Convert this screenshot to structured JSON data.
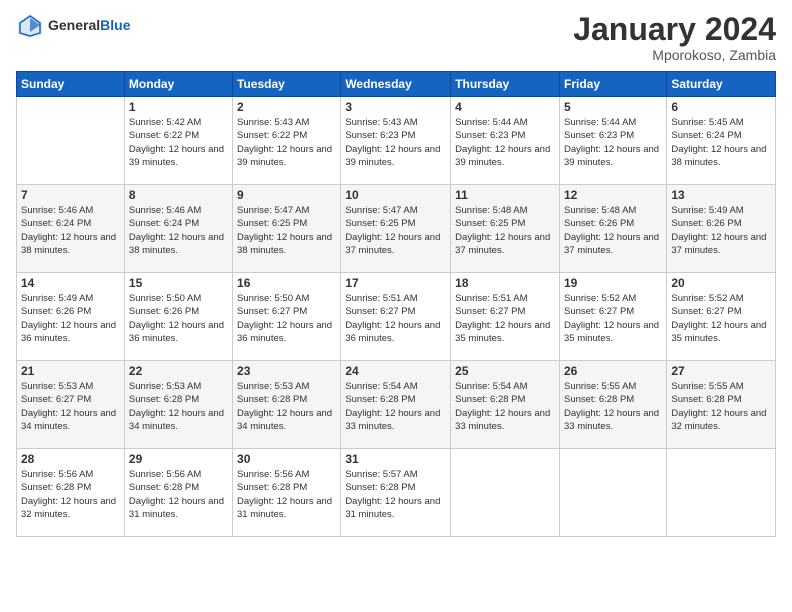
{
  "logo": {
    "general": "General",
    "blue": "Blue"
  },
  "header": {
    "month_year": "January 2024",
    "location": "Mporokoso, Zambia"
  },
  "days_header": [
    "Sunday",
    "Monday",
    "Tuesday",
    "Wednesday",
    "Thursday",
    "Friday",
    "Saturday"
  ],
  "weeks": [
    [
      {
        "num": "",
        "info": ""
      },
      {
        "num": "1",
        "info": "Sunrise: 5:42 AM\nSunset: 6:22 PM\nDaylight: 12 hours\nand 39 minutes."
      },
      {
        "num": "2",
        "info": "Sunrise: 5:43 AM\nSunset: 6:22 PM\nDaylight: 12 hours\nand 39 minutes."
      },
      {
        "num": "3",
        "info": "Sunrise: 5:43 AM\nSunset: 6:23 PM\nDaylight: 12 hours\nand 39 minutes."
      },
      {
        "num": "4",
        "info": "Sunrise: 5:44 AM\nSunset: 6:23 PM\nDaylight: 12 hours\nand 39 minutes."
      },
      {
        "num": "5",
        "info": "Sunrise: 5:44 AM\nSunset: 6:23 PM\nDaylight: 12 hours\nand 39 minutes."
      },
      {
        "num": "6",
        "info": "Sunrise: 5:45 AM\nSunset: 6:24 PM\nDaylight: 12 hours\nand 38 minutes."
      }
    ],
    [
      {
        "num": "7",
        "info": "Sunrise: 5:46 AM\nSunset: 6:24 PM\nDaylight: 12 hours\nand 38 minutes."
      },
      {
        "num": "8",
        "info": "Sunrise: 5:46 AM\nSunset: 6:24 PM\nDaylight: 12 hours\nand 38 minutes."
      },
      {
        "num": "9",
        "info": "Sunrise: 5:47 AM\nSunset: 6:25 PM\nDaylight: 12 hours\nand 38 minutes."
      },
      {
        "num": "10",
        "info": "Sunrise: 5:47 AM\nSunset: 6:25 PM\nDaylight: 12 hours\nand 37 minutes."
      },
      {
        "num": "11",
        "info": "Sunrise: 5:48 AM\nSunset: 6:25 PM\nDaylight: 12 hours\nand 37 minutes."
      },
      {
        "num": "12",
        "info": "Sunrise: 5:48 AM\nSunset: 6:26 PM\nDaylight: 12 hours\nand 37 minutes."
      },
      {
        "num": "13",
        "info": "Sunrise: 5:49 AM\nSunset: 6:26 PM\nDaylight: 12 hours\nand 37 minutes."
      }
    ],
    [
      {
        "num": "14",
        "info": "Sunrise: 5:49 AM\nSunset: 6:26 PM\nDaylight: 12 hours\nand 36 minutes."
      },
      {
        "num": "15",
        "info": "Sunrise: 5:50 AM\nSunset: 6:26 PM\nDaylight: 12 hours\nand 36 minutes."
      },
      {
        "num": "16",
        "info": "Sunrise: 5:50 AM\nSunset: 6:27 PM\nDaylight: 12 hours\nand 36 minutes."
      },
      {
        "num": "17",
        "info": "Sunrise: 5:51 AM\nSunset: 6:27 PM\nDaylight: 12 hours\nand 36 minutes."
      },
      {
        "num": "18",
        "info": "Sunrise: 5:51 AM\nSunset: 6:27 PM\nDaylight: 12 hours\nand 35 minutes."
      },
      {
        "num": "19",
        "info": "Sunrise: 5:52 AM\nSunset: 6:27 PM\nDaylight: 12 hours\nand 35 minutes."
      },
      {
        "num": "20",
        "info": "Sunrise: 5:52 AM\nSunset: 6:27 PM\nDaylight: 12 hours\nand 35 minutes."
      }
    ],
    [
      {
        "num": "21",
        "info": "Sunrise: 5:53 AM\nSunset: 6:27 PM\nDaylight: 12 hours\nand 34 minutes."
      },
      {
        "num": "22",
        "info": "Sunrise: 5:53 AM\nSunset: 6:28 PM\nDaylight: 12 hours\nand 34 minutes."
      },
      {
        "num": "23",
        "info": "Sunrise: 5:53 AM\nSunset: 6:28 PM\nDaylight: 12 hours\nand 34 minutes."
      },
      {
        "num": "24",
        "info": "Sunrise: 5:54 AM\nSunset: 6:28 PM\nDaylight: 12 hours\nand 33 minutes."
      },
      {
        "num": "25",
        "info": "Sunrise: 5:54 AM\nSunset: 6:28 PM\nDaylight: 12 hours\nand 33 minutes."
      },
      {
        "num": "26",
        "info": "Sunrise: 5:55 AM\nSunset: 6:28 PM\nDaylight: 12 hours\nand 33 minutes."
      },
      {
        "num": "27",
        "info": "Sunrise: 5:55 AM\nSunset: 6:28 PM\nDaylight: 12 hours\nand 32 minutes."
      }
    ],
    [
      {
        "num": "28",
        "info": "Sunrise: 5:56 AM\nSunset: 6:28 PM\nDaylight: 12 hours\nand 32 minutes."
      },
      {
        "num": "29",
        "info": "Sunrise: 5:56 AM\nSunset: 6:28 PM\nDaylight: 12 hours\nand 31 minutes."
      },
      {
        "num": "30",
        "info": "Sunrise: 5:56 AM\nSunset: 6:28 PM\nDaylight: 12 hours\nand 31 minutes."
      },
      {
        "num": "31",
        "info": "Sunrise: 5:57 AM\nSunset: 6:28 PM\nDaylight: 12 hours\nand 31 minutes."
      },
      {
        "num": "",
        "info": ""
      },
      {
        "num": "",
        "info": ""
      },
      {
        "num": "",
        "info": ""
      }
    ]
  ]
}
